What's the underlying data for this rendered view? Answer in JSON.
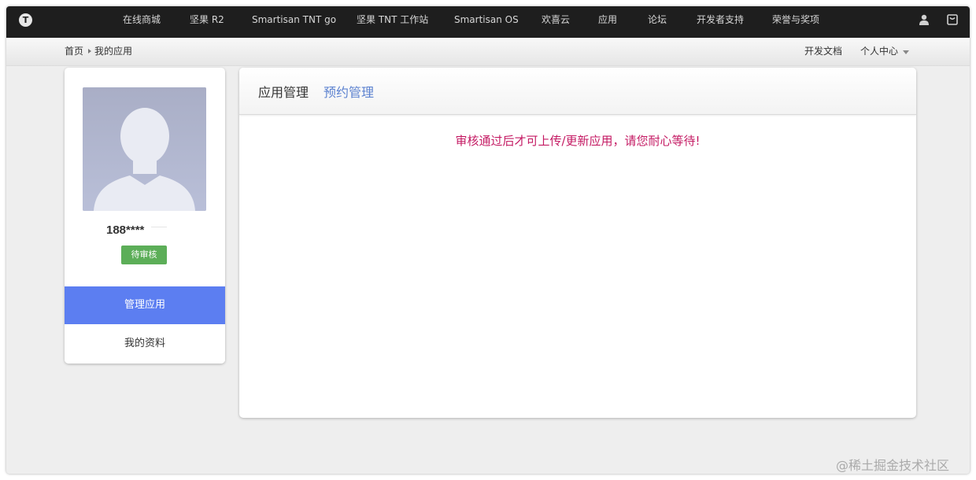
{
  "nav": {
    "logo_letter": "T",
    "items": [
      "在线商城",
      "坚果 R2",
      "Smartisan TNT go",
      "坚果 TNT 工作站",
      "Smartisan OS",
      "欢喜云",
      "应用",
      "论坛",
      "开发者支持",
      "荣誉与奖项"
    ]
  },
  "breadcrumb": {
    "home": "首页",
    "current": "我的应用"
  },
  "subnav": {
    "docs": "开发文档",
    "user_center": "个人中心"
  },
  "profile": {
    "username": "188****",
    "status": "待审核",
    "menu": [
      "管理应用",
      "我的资料"
    ]
  },
  "panel": {
    "tabs": [
      "应用管理",
      "预约管理"
    ],
    "notice": "审核通过后才可上传/更新应用，请您耐心等待!"
  },
  "watermark": "@稀土掘金技术社区",
  "colors": {
    "nav_bg": "#1e1e1e",
    "active_menu": "#5c7ef1",
    "badge": "#5cae58",
    "notice": "#c41a63",
    "tab_link": "#5c82d0"
  }
}
